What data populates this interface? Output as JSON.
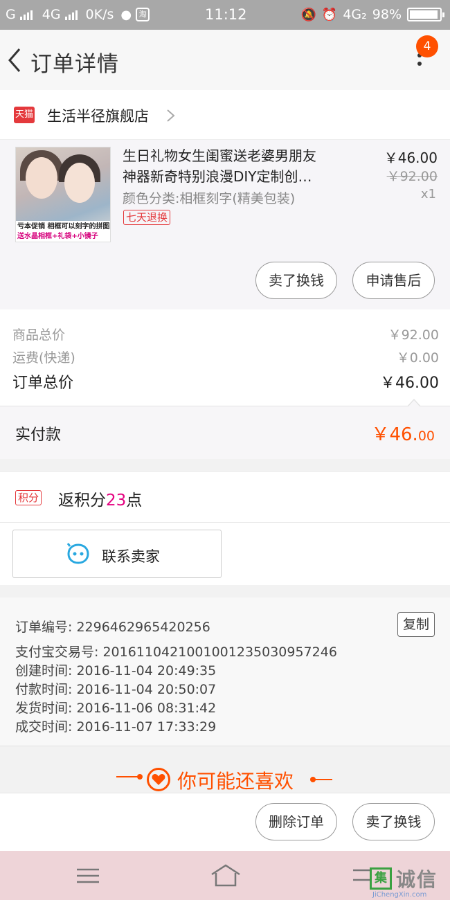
{
  "status_bar": {
    "carrier_left": "G",
    "network": "4G",
    "speed": "0K/s",
    "app_badge": "淘",
    "time": "11:12",
    "network_right": "4G₂",
    "battery": "98%"
  },
  "header": {
    "title": "订单详情",
    "notification_count": "4"
  },
  "shop": {
    "logo_text": "天猫",
    "name": "生活半径旗舰店"
  },
  "product": {
    "title_line1": "生日礼物女生闺蜜送老婆男朋友",
    "title_line2": "神器新奇特别浪漫DIY定制创…",
    "sku": "颜色分类:相框刻字(精美包装)",
    "tag": "七天退换",
    "price": "￥46.00",
    "original_price": "￥92.00",
    "quantity": "x1",
    "thumb_promo1": "亏本促销   相框可以刻字的拼图",
    "thumb_promo2": "送水晶相框+礼袋+小镜子",
    "actions": [
      "卖了换钱",
      "申请售后"
    ]
  },
  "summary": {
    "rows": [
      {
        "label": "商品总价",
        "value": "￥92.00"
      },
      {
        "label": "运费(快递)",
        "value": "￥0.00"
      },
      {
        "label": "订单总价",
        "value": "￥46.00"
      }
    ],
    "paid_label": "实付款",
    "paid_value_main": "￥46.",
    "paid_value_cents": "00"
  },
  "points": {
    "tag": "积分",
    "prefix": "返积分",
    "value": "23",
    "suffix": "点"
  },
  "contact": {
    "label": "联系卖家"
  },
  "order_info": {
    "copy_label": "复制",
    "rows": [
      "订单编号: 2296462965420256",
      "支付宝交易号: 2016110421001001235030957246",
      "创建时间: 2016-11-04  20:49:35",
      "付款时间: 2016-11-04  20:50:07",
      "发货时间: 2016-11-06  08:31:42",
      "成交时间: 2016-11-07  17:33:29"
    ]
  },
  "recommend": {
    "title": "你可能还喜欢"
  },
  "footer_actions": [
    "删除订单",
    "卖了换钱"
  ],
  "watermark": {
    "box": "集",
    "text": "诚信",
    "url": "JiChengXin.com"
  },
  "colors": {
    "accent": "#ff5000",
    "tmall_red": "#e4393c",
    "points_pink": "#e4007f"
  }
}
